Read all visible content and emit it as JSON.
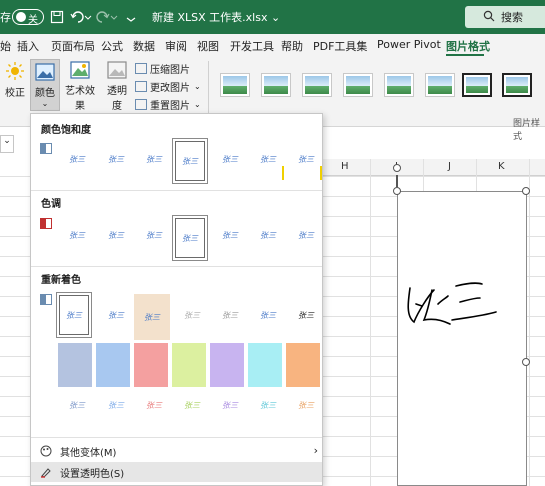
{
  "titlebar": {
    "autosave_label": "存",
    "autosave_state": "关",
    "title": "新建 XLSX 工作表.xlsx ⌄",
    "search_label": "搜索",
    "save_icon": "save-icon",
    "undo_icon": "undo-icon",
    "redo_icon": "redo-icon",
    "bg_color": "#217346"
  },
  "tabs": [
    {
      "label": "始"
    },
    {
      "label": "插入"
    },
    {
      "label": "页面布局"
    },
    {
      "label": "公式"
    },
    {
      "label": "数据"
    },
    {
      "label": "审阅"
    },
    {
      "label": "视图"
    },
    {
      "label": "开发工具"
    },
    {
      "label": "帮助"
    },
    {
      "label": "PDF工具集"
    },
    {
      "label": "Power Pivot"
    },
    {
      "label": "图片格式",
      "active": true
    }
  ],
  "ribbon": {
    "correct_label": "校正",
    "color_label": "颜色",
    "artistic_label": "艺术效果",
    "transparency_label_1": "透明",
    "transparency_label_2": "度",
    "compress_label": "压缩图片",
    "change_label": "更改图片",
    "reset_label": "重置图片",
    "styles_group_label": "图片样式"
  },
  "sheet": {
    "namebox": "⌄",
    "columns": [
      "H",
      "I",
      "J",
      "K"
    ]
  },
  "dropdown": {
    "saturation_title": "颜色饱和度",
    "tone_title": "色调",
    "recolor_title": "重新着色",
    "thumb_text": "张三",
    "recolor_colors": [
      "#b4c3e0",
      "#a8c8f0",
      "#f4a0a0",
      "#dcf0a0",
      "#c8b4f0",
      "#a8eef4",
      "#f8b480"
    ],
    "more_variants_label": "其他变体(M)",
    "set_transparent_label": "设置透明色(S)"
  },
  "picture": {
    "signature_text": "张三"
  }
}
